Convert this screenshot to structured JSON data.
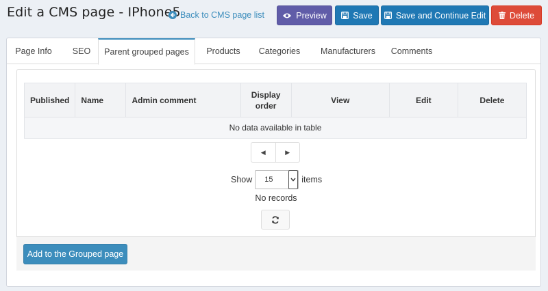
{
  "header": {
    "title": "Edit a CMS page - IPhone5",
    "back_link": "Back to CMS page list",
    "buttons": {
      "preview": "Preview",
      "save": "Save",
      "save_continue": "Save and Continue Edit",
      "delete": "Delete"
    }
  },
  "tabs": [
    {
      "label": "Page Info",
      "active": false
    },
    {
      "label": "SEO",
      "active": false
    },
    {
      "label": "Parent grouped pages",
      "active": true
    },
    {
      "label": "Products",
      "active": false
    },
    {
      "label": "Categories",
      "active": false
    },
    {
      "label": "Manufacturers",
      "active": false
    },
    {
      "label": "Comments",
      "active": false
    }
  ],
  "grid": {
    "columns": [
      "Published",
      "Name",
      "Admin comment",
      "Display order",
      "View",
      "Edit",
      "Delete"
    ],
    "empty_text": "No data available in table"
  },
  "pager": {
    "show_label": "Show",
    "page_size": "15",
    "items_label": "items",
    "records_text": "No records"
  },
  "footer": {
    "add_button": "Add to the Grouped page"
  },
  "colors": {
    "preview": "#605ca8",
    "save": "#1f78b4",
    "delete": "#dd4b39",
    "primary": "#3c8dbc"
  }
}
